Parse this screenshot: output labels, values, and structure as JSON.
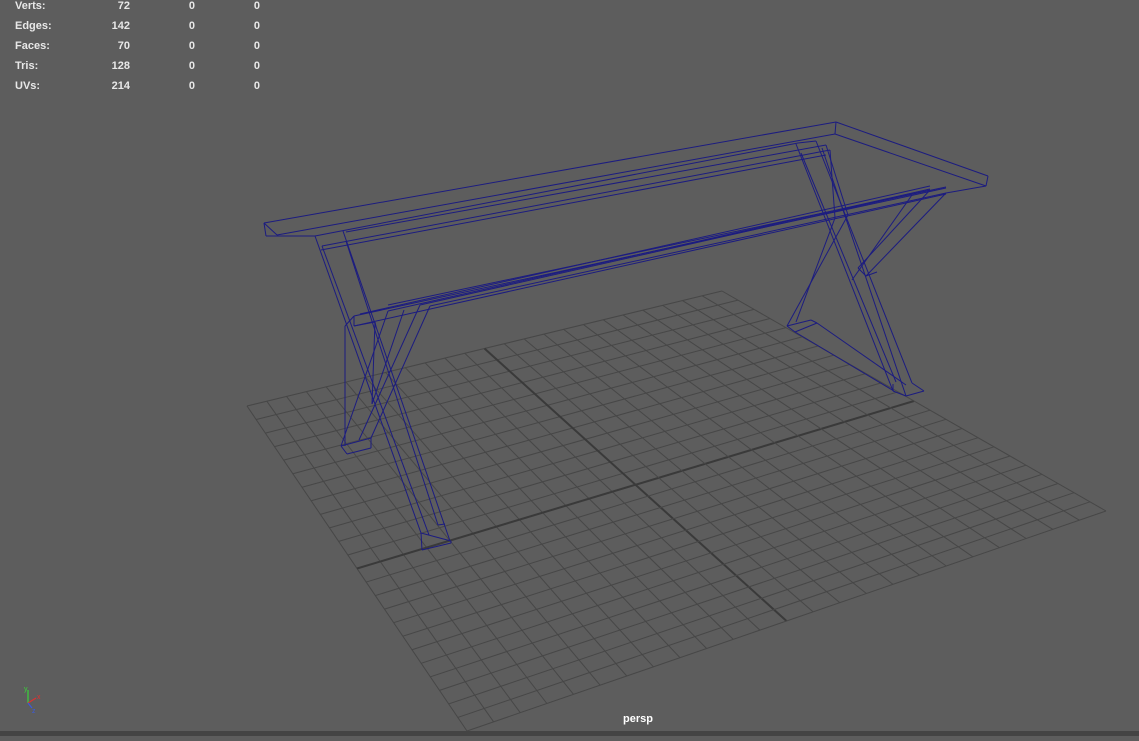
{
  "viewport": {
    "camera_label": "persp",
    "background": "#5d5d5d",
    "grid_color": "#474747",
    "grid_axis_color": "#3a3a3a",
    "wireframe_color": "#1c1c80"
  },
  "hud": {
    "rows": [
      {
        "label": "Verts:",
        "v1": "72",
        "v2": "0",
        "v3": "0"
      },
      {
        "label": "Edges:",
        "v1": "142",
        "v2": "0",
        "v3": "0"
      },
      {
        "label": "Faces:",
        "v1": "70",
        "v2": "0",
        "v3": "0"
      },
      {
        "label": "Tris:",
        "v1": "128",
        "v2": "0",
        "v3": "0"
      },
      {
        "label": "UVs:",
        "v1": "214",
        "v2": "0",
        "v3": "0"
      }
    ]
  },
  "axis_gizmo": {
    "x": "x",
    "y": "y",
    "z": "z"
  }
}
